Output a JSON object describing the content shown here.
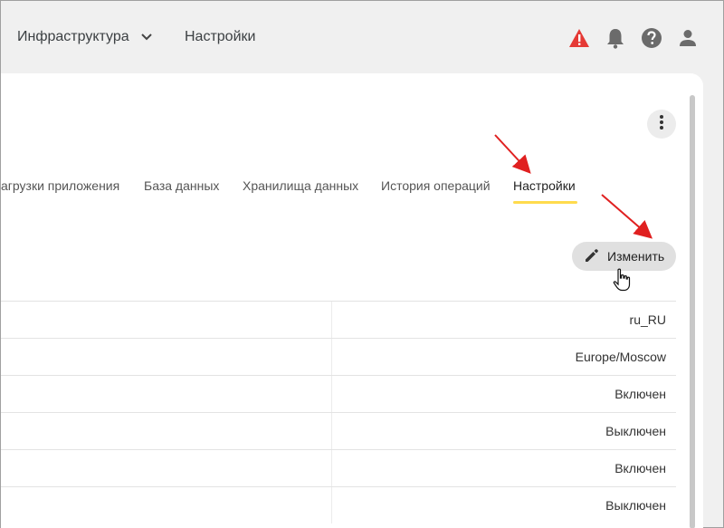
{
  "topbar": {
    "infra_label": "Инфраструктура",
    "settings_label": "Настройки",
    "icons": [
      "warning-icon",
      "bell-icon",
      "help-icon",
      "user-icon"
    ],
    "warning_color": "#e53935"
  },
  "tabs": [
    {
      "label": "агрузки приложения",
      "active": false
    },
    {
      "label": "База данных",
      "active": false
    },
    {
      "label": "Хранилища данных",
      "active": false
    },
    {
      "label": "История операций",
      "active": false
    },
    {
      "label": "Настройки",
      "active": true
    }
  ],
  "tab_accent": "#ffdb4d",
  "edit_button": {
    "label": "Изменить",
    "icon": "pencil-icon"
  },
  "settings_rows": [
    {
      "value": "ru_RU"
    },
    {
      "value": "Europe/Moscow"
    },
    {
      "value": "Включен"
    },
    {
      "value": "Выключен"
    },
    {
      "value": "Включен"
    },
    {
      "value": "Выключен"
    }
  ],
  "annotation_color": "#e02020"
}
